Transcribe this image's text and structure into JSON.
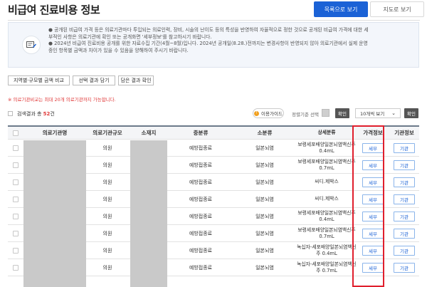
{
  "page": {
    "title": "비급여 진료비용 정보",
    "view_list_label": "목록으로 보기",
    "view_map_label": "지도로 보기"
  },
  "info": {
    "lines": [
      "● 공개된 비급여 가격 등은 의료기관마다 투입되는 의료인력, 장비, 시술의 난이도 등의 특성을 반영하여 자율적으로 정한 것으로 공개된 비급여 가격에 대한 세",
      "부적인 사항은 의료기관에 확인 또는 공개화면 '세부정보'를 참고하시기 바랍니다.",
      "● 2024년 비급여 진료비용 공개를 위한 자료수집 기간(4월~8월)입니다. 2024년 공개일(8.28.)전까지는 변경사항이 반영되지 않아 의료기관에서 실제 운영",
      "중인 항목별 금액과 차이가 있을 수 있음을 양해하여 주시기 바랍니다."
    ]
  },
  "actions": {
    "compare_label": "지역별·규모별 금액 비교",
    "load_label": "선택 결과 담기",
    "check_label": "담은 결과 확인"
  },
  "notice": "※ 의료기관비교는 최대 20개 의료기관까지 가능합니다.",
  "search": {
    "label_prefix": "검색결과 총 ",
    "count": "52",
    "label_suffix": "건",
    "guide_label": "이용가이드",
    "sort_label": "정렬기준 선택",
    "confirm_label": "확인",
    "per_page": "10개씩 보기"
  },
  "table": {
    "headers": [
      "의료기관명",
      "의료기관규모",
      "소재지",
      "중분류",
      "소분류",
      "상세분류",
      "가격정보",
      "기관정보"
    ],
    "detail_label": "세부",
    "inst_label": "기관",
    "rows": [
      {
        "size": "의원",
        "mid": "예방접종료",
        "small": "일본뇌염",
        "detail": "보령세포배양일본뇌염백신주 0.4mL"
      },
      {
        "size": "의원",
        "mid": "예방접종료",
        "small": "일본뇌염",
        "detail": "보령세포배양일본뇌염백신주 0.7mL"
      },
      {
        "size": "의원",
        "mid": "예방접종료",
        "small": "일본뇌염",
        "detail": "씨디.제박스"
      },
      {
        "size": "의원",
        "mid": "예방접종료",
        "small": "일본뇌염",
        "detail": "씨디.제박스"
      },
      {
        "size": "의원",
        "mid": "예방접종료",
        "small": "일본뇌염",
        "detail": "보령세포배양일본뇌염백신주 0.4mL"
      },
      {
        "size": "의원",
        "mid": "예방접종료",
        "small": "일본뇌염",
        "detail": "보령세포배양일본뇌염백신주 0.7mL"
      },
      {
        "size": "의원",
        "mid": "예방접종료",
        "small": "일본뇌염",
        "detail": "녹십자-세포배양일본뇌염백신주 0.4mL"
      },
      {
        "size": "의원",
        "mid": "예방접종료",
        "small": "일본뇌염",
        "detail": "녹십자-세포배양일본뇌염백신주 0.7mL"
      }
    ]
  },
  "colors": {
    "primary": "#1b62d6",
    "highlight": "#e01f2d",
    "count": "#e03a3a"
  }
}
